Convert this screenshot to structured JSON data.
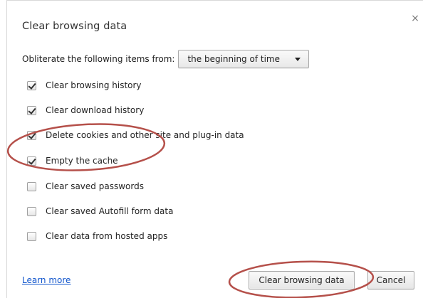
{
  "dialog": {
    "title": "Clear browsing data",
    "close_symbol": "×"
  },
  "range": {
    "label": "Obliterate the following items from:",
    "selected": "the beginning of time"
  },
  "options": [
    {
      "label": "Clear browsing history",
      "checked": true
    },
    {
      "label": "Clear download history",
      "checked": true
    },
    {
      "label": "Delete cookies and other site and plug-in data",
      "checked": true
    },
    {
      "label": "Empty the cache",
      "checked": true
    },
    {
      "label": "Clear saved passwords",
      "checked": false
    },
    {
      "label": "Clear saved Autofill form data",
      "checked": false
    },
    {
      "label": "Clear data from hosted apps",
      "checked": false
    }
  ],
  "footer": {
    "learn_more": "Learn more",
    "clear_button": "Clear browsing data",
    "cancel_button": "Cancel"
  },
  "colors": {
    "link": "#1155cc",
    "annotation_ellipse": "#b5504a"
  }
}
